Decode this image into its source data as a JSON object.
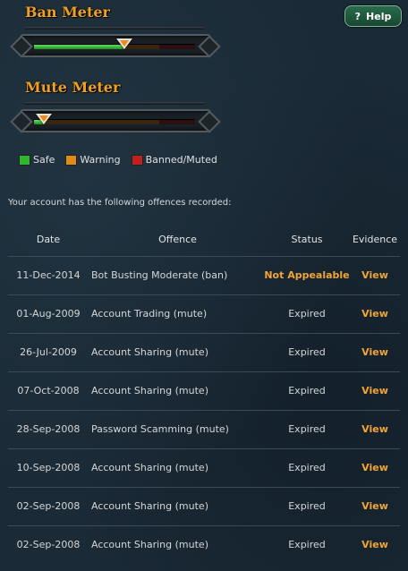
{
  "ban_meter": {
    "title": "Ban Meter",
    "level": 0.56
  },
  "mute_meter": {
    "title": "Mute Meter",
    "level": 0.06
  },
  "help_button": {
    "icon": "question-icon",
    "icon_glyph": "?",
    "label": "Help"
  },
  "legend": [
    {
      "label": "Safe",
      "color": "#2fb62f"
    },
    {
      "label": "Warning",
      "color": "#e08a1a"
    },
    {
      "label": "Banned/Muted",
      "color": "#c0201e"
    }
  ],
  "summary": "Your account has the following offences recorded:",
  "table": {
    "columns": [
      "Date",
      "Offence",
      "Status",
      "Evidence"
    ],
    "rows": [
      {
        "date": "11-Dec-2014",
        "offence": "Bot Busting Moderate (ban)",
        "status": "Not Appealable",
        "evidence": "View"
      },
      {
        "date": "01-Aug-2009",
        "offence": "Account Trading (mute)",
        "status": "Expired",
        "evidence": "View"
      },
      {
        "date": "26-Jul-2009",
        "offence": "Account Sharing (mute)",
        "status": "Expired",
        "evidence": "View"
      },
      {
        "date": "07-Oct-2008",
        "offence": "Account Sharing (mute)",
        "status": "Expired",
        "evidence": "View"
      },
      {
        "date": "28-Sep-2008",
        "offence": "Password Scamming (mute)",
        "status": "Expired",
        "evidence": "View"
      },
      {
        "date": "10-Sep-2008",
        "offence": "Account Sharing (mute)",
        "status": "Expired",
        "evidence": "View"
      },
      {
        "date": "02-Sep-2008",
        "offence": "Account Sharing (mute)",
        "status": "Expired",
        "evidence": "View"
      },
      {
        "date": "02-Sep-2008",
        "offence": "Account Sharing (mute)",
        "status": "Expired",
        "evidence": "View"
      }
    ]
  },
  "colors": {
    "accent": "#f2a533",
    "title": "#f0a020",
    "help_button": "#1f5a3d"
  }
}
